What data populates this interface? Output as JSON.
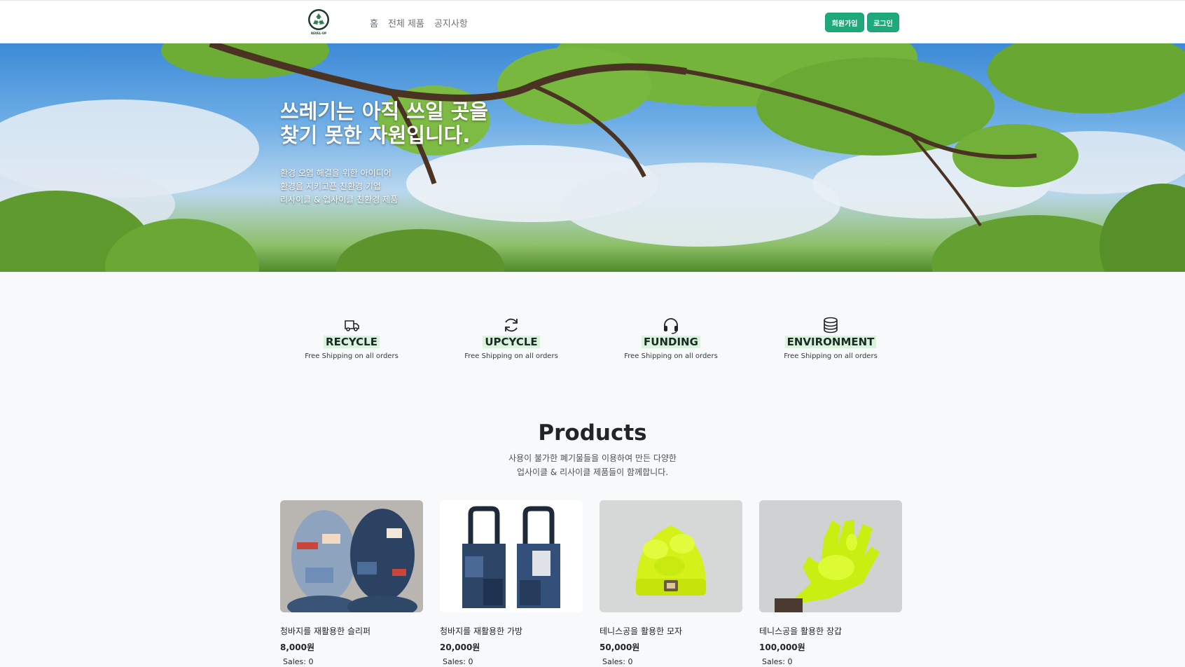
{
  "header": {
    "logo_text": "REVEL-UP",
    "nav": [
      "홈",
      "전체 제품",
      "공지사항"
    ],
    "signup_label": "회원가입",
    "login_label": "로그인"
  },
  "hero": {
    "title": "쓰레기는 아직 쓰일 곳을\n찾기 못한 자원입니다.",
    "subtitle": "환경 오염 해결을 위한 아이디어\n환경을 지키고픈 친환경 기업\n리사이클 & 업사이클 친환경 제품"
  },
  "features": [
    {
      "title": "RECYCLE",
      "desc": "Free Shipping on all orders",
      "icon": "truck-icon"
    },
    {
      "title": "UPCYCLE",
      "desc": "Free Shipping on all orders",
      "icon": "refresh-icon"
    },
    {
      "title": "FUNDING",
      "desc": "Free Shipping on all orders",
      "icon": "headset-icon"
    },
    {
      "title": "ENVIRONMENT",
      "desc": "Free Shipping on all orders",
      "icon": "database-icon"
    }
  ],
  "products": {
    "title": "Products",
    "subtitle": "사용이 불가한 폐기물들을 이용하여 만든 다양한\n업사이클 & 리사이클 제품들이 함께합니다.",
    "items": [
      {
        "name": "청바지를 재활용한 슬리퍼",
        "price": "8,000원",
        "sales": "Sales: 0"
      },
      {
        "name": "청바지를 재활용한 가방",
        "price": "20,000원",
        "sales": "Sales: 0"
      },
      {
        "name": "테니스공을 활용한 모자",
        "price": "50,000원",
        "sales": "Sales: 0"
      },
      {
        "name": "테니스공을 활용한 장갑",
        "price": "100,000원",
        "sales": "Sales: 0"
      }
    ]
  },
  "colors": {
    "accent": "#1fa97a",
    "feature_highlight": "#d9f3dc",
    "background": "#f8f9fa"
  }
}
